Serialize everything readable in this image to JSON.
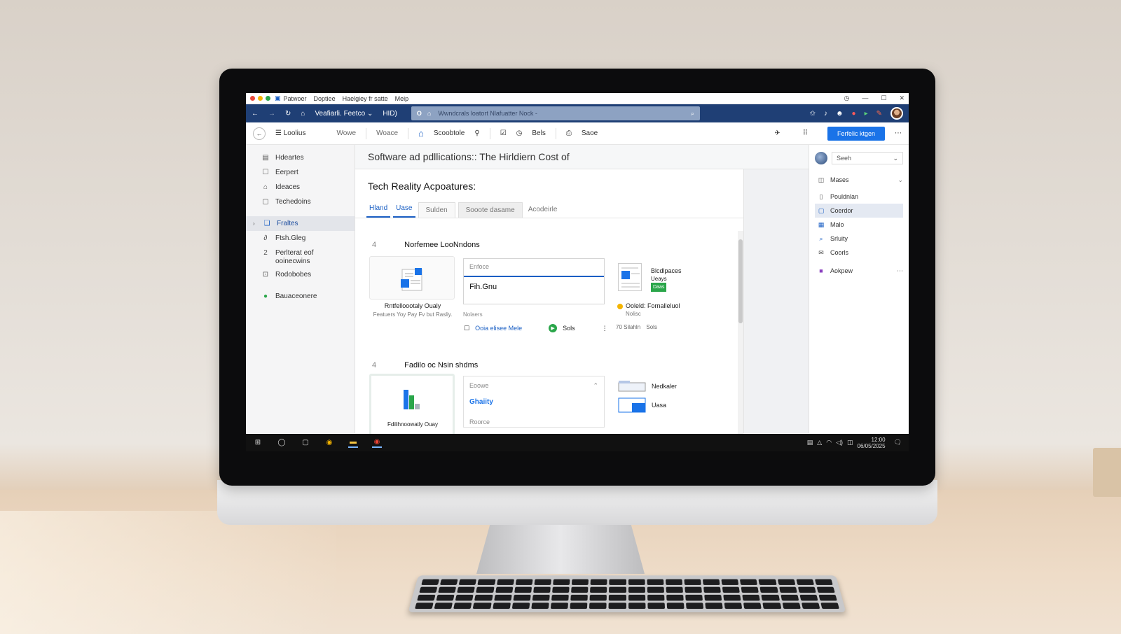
{
  "titlebar": {
    "menu": [
      "Patwoer",
      "Doptiee",
      "Haelgiey fr satte",
      "Meip"
    ],
    "dot_colors": [
      "#e94b3c",
      "#f4b400",
      "#2aa64a"
    ]
  },
  "navbar": {
    "profile_label": "Veafiarli. Feetco",
    "hid_label": "HID)",
    "url_prefix": "O",
    "search_placeholder": "Wwndcrals loatort Nlafuatter Nock -"
  },
  "toolbar": {
    "menu_label": "Loolius",
    "item_1": "Wowe",
    "item_2": "Woace",
    "item_3": "Scoobtole",
    "item_4": "Bels",
    "item_5": "Saoe",
    "primary_button": "Ferfelic ktgen"
  },
  "sidebar": {
    "items": [
      {
        "label": "Hdeartes",
        "icon": "table-icon"
      },
      {
        "label": "Eerpert",
        "icon": "square-icon"
      },
      {
        "label": "Ideaces",
        "icon": "home-icon"
      },
      {
        "label": "Techedoins",
        "icon": "tag-icon"
      },
      {
        "label": "Fraltes",
        "icon": "layers-icon"
      },
      {
        "label": "Ftsh.Gleg",
        "icon": "link-icon"
      },
      {
        "label": "Perlterat eof",
        "sub": "ooinecwins",
        "icon": "sort-icon"
      },
      {
        "label": "Rodobobes",
        "icon": "grid-icon"
      },
      {
        "label": "Bauaceonere",
        "icon": "leaf-icon"
      }
    ]
  },
  "main": {
    "doc_title": "Software ad pdllications:: The Hirldiern Cost of",
    "card_title": "Tech Reality Acpoatures:",
    "tabs": [
      "Hland",
      "Uase",
      "Sulden",
      "Sooote dasame",
      "Acodeirle"
    ],
    "section1": {
      "marker": "4",
      "title": "Norfemee LooNndons",
      "tile_caption": "Rntfelloootaly Oualy",
      "tile_sub": "Featuers Yoy Pay Fv but Rasliy.",
      "field_label": "Enfoce",
      "field_value": "Fih.Gnu",
      "meta": "Nolaers",
      "link_text": "Ooia elisee Mele",
      "play_label": "Sols",
      "side_title": "Blcdlpaces",
      "side_sub": "Ueays",
      "side_badge": "Daas",
      "status_label": "Ooleld: Fornalleluol",
      "status_sub": "Nolisc",
      "status_meta": "70  Silahln",
      "status_meta2": "Sols"
    },
    "section2": {
      "marker": "4",
      "title": "Fadilo oc Nsin shdms",
      "tile_caption": "Fdilihnoowatly Ouay",
      "dd_label": "Eoowe",
      "dd_value": "Ghaiity",
      "dd_footer": "Roorce",
      "side_1": "Nedkaler",
      "side_2": "Uasa"
    }
  },
  "rightpanel": {
    "search": "Seeh",
    "items": [
      {
        "label": "Mases",
        "icon": "chat-icon"
      },
      {
        "label": "Pouldnlan",
        "icon": "file-icon"
      },
      {
        "label": "Coerdor",
        "icon": "square-icon"
      },
      {
        "label": "Malo",
        "icon": "grid-icon"
      },
      {
        "label": "Srluity",
        "icon": "search-icon"
      },
      {
        "label": "Coorls",
        "icon": "mail-icon"
      },
      {
        "label": "Aokpew",
        "icon": "app-icon"
      }
    ]
  },
  "taskbar": {
    "time": "12:00",
    "date": "06/05/2025"
  }
}
